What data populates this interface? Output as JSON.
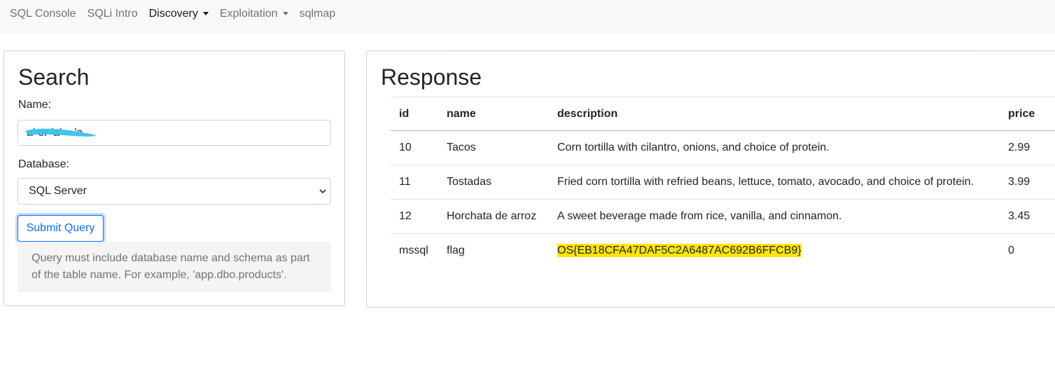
{
  "navbar": {
    "items": [
      {
        "label": "SQL Console",
        "dropdown": false,
        "active": false
      },
      {
        "label": "SQLi Intro",
        "dropdown": false,
        "active": false
      },
      {
        "label": "Discovery",
        "dropdown": true,
        "active": true
      },
      {
        "label": "Exploitation",
        "dropdown": true,
        "active": false
      },
      {
        "label": "sqlmap",
        "dropdown": false,
        "active": false
      }
    ]
  },
  "search": {
    "title": "Search",
    "name_label": "Name:",
    "name_value": "a' or 'a' = 'a",
    "database_label": "Database:",
    "database_selected": "SQL Server",
    "submit_label": "Submit Query",
    "help_text": "Query must include database name and schema as part of the table name. For example, 'app.dbo.products'."
  },
  "response": {
    "title": "Response",
    "columns": [
      "id",
      "name",
      "description",
      "price"
    ],
    "rows": [
      {
        "id": "10",
        "name": "Tacos",
        "description": "Corn tortilla with cilantro, onions, and choice of protein.",
        "price": "2.99"
      },
      {
        "id": "11",
        "name": "Tostadas",
        "description": "Fried corn tortilla with refried beans, lettuce, tomato, avocado, and choice of protein.",
        "price": "3.99"
      },
      {
        "id": "12",
        "name": "Horchata de arroz",
        "description": "A sweet beverage made from rice, vanilla, and cinnamon.",
        "price": "3.45"
      },
      {
        "id": "mssql",
        "name": "flag",
        "description": "OS{EB18CFA47DAF5C2A6487AC692B6FFCB9}",
        "price": "0"
      }
    ]
  },
  "colors": {
    "primary": "#0d6efd",
    "annotation_blue": "#3cc3ee",
    "annotation_yellow": "#ffe600"
  }
}
